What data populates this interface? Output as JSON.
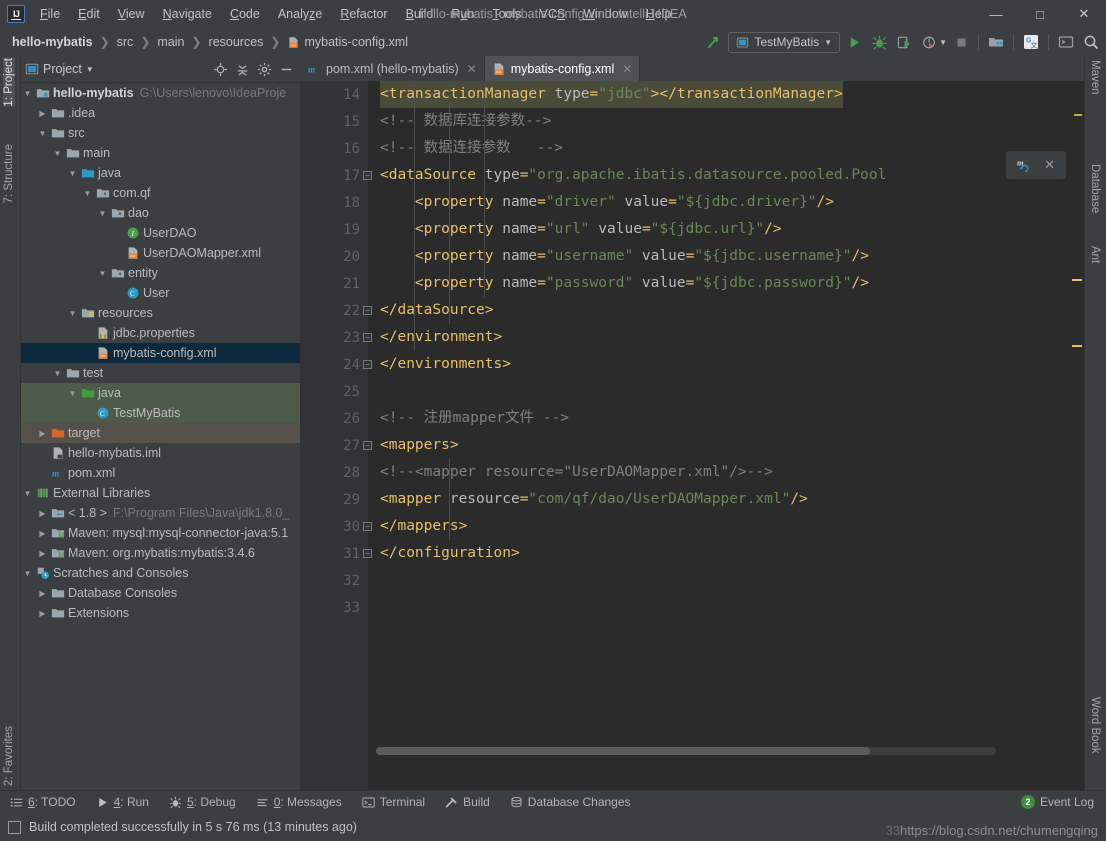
{
  "window": {
    "title": "hello-mybatis - mybatis-config.xml - IntelliJ IDEA",
    "minimize": "—",
    "maximize": "□",
    "close": "✕"
  },
  "menubar": {
    "logo": "IJ",
    "items": [
      {
        "label": "File",
        "mnemonic": "F"
      },
      {
        "label": "Edit",
        "mnemonic": "E"
      },
      {
        "label": "View",
        "mnemonic": "V"
      },
      {
        "label": "Navigate",
        "mnemonic": "N"
      },
      {
        "label": "Code",
        "mnemonic": "C"
      },
      {
        "label": "Analyze",
        "mnemonic": "z"
      },
      {
        "label": "Refactor",
        "mnemonic": "R"
      },
      {
        "label": "Build",
        "mnemonic": "B"
      },
      {
        "label": "Run",
        "mnemonic": "u"
      },
      {
        "label": "Tools",
        "mnemonic": "T"
      },
      {
        "label": "VCS",
        "mnemonic": "S"
      },
      {
        "label": "Window",
        "mnemonic": "W"
      },
      {
        "label": "Help",
        "mnemonic": "H"
      }
    ]
  },
  "breadcrumbs": [
    {
      "label": "hello-mybatis",
      "bold": true,
      "icon": ""
    },
    {
      "label": "src",
      "bold": false,
      "icon": ""
    },
    {
      "label": "main",
      "bold": false,
      "icon": ""
    },
    {
      "label": "resources",
      "bold": false,
      "icon": ""
    },
    {
      "label": "mybatis-config.xml",
      "bold": false,
      "icon": "xml-file-icon"
    }
  ],
  "toolbar": {
    "run_config": "TestMyBatis",
    "icons": [
      "make-project-icon",
      "run-icon",
      "debug-icon",
      "run-with-coverage-icon",
      "profile-icon",
      "stop-icon",
      "project-structure-icon",
      "translate-icon",
      "open-terminal-icon",
      "search-everywhere-icon"
    ]
  },
  "left_strip": {
    "project": "1: Project",
    "structure": "7: Structure",
    "favorites": "2: Favorites"
  },
  "right_strip": {
    "maven": "Maven",
    "database": "Database",
    "ant": "Ant",
    "word_book": "Word Book"
  },
  "project_panel": {
    "title": "Project",
    "actions": [
      "locate-icon",
      "collapse-all-icon",
      "settings-gear-icon",
      "hide-icon"
    ],
    "tree": [
      {
        "depth": 0,
        "twisty": "down",
        "icon": "module-folder-icon",
        "label": "hello-mybatis",
        "bold": true,
        "dim": "G:\\Users\\lenovo\\IdeaProje",
        "state": "none"
      },
      {
        "depth": 1,
        "twisty": "right",
        "icon": "folder-icon",
        "label": ".idea",
        "bold": false,
        "dim": "",
        "state": "none"
      },
      {
        "depth": 1,
        "twisty": "down",
        "icon": "folder-icon",
        "label": "src",
        "bold": false,
        "dim": "",
        "state": "none"
      },
      {
        "depth": 2,
        "twisty": "down",
        "icon": "folder-icon",
        "label": "main",
        "bold": false,
        "dim": "",
        "state": "none"
      },
      {
        "depth": 3,
        "twisty": "down",
        "icon": "source-root-icon",
        "label": "java",
        "bold": false,
        "dim": "",
        "state": "none"
      },
      {
        "depth": 4,
        "twisty": "down",
        "icon": "package-icon",
        "label": "com.qf",
        "bold": false,
        "dim": "",
        "state": "none"
      },
      {
        "depth": 5,
        "twisty": "down",
        "icon": "package-icon",
        "label": "dao",
        "bold": false,
        "dim": "",
        "state": "none"
      },
      {
        "depth": 6,
        "twisty": "none",
        "icon": "interface-icon",
        "label": "UserDAO",
        "bold": false,
        "dim": "",
        "state": "none"
      },
      {
        "depth": 6,
        "twisty": "none",
        "icon": "xml-file-icon",
        "label": "UserDAOMapper.xml",
        "bold": false,
        "dim": "",
        "state": "none"
      },
      {
        "depth": 5,
        "twisty": "down",
        "icon": "package-icon",
        "label": "entity",
        "bold": false,
        "dim": "",
        "state": "none"
      },
      {
        "depth": 6,
        "twisty": "none",
        "icon": "class-icon",
        "label": "User",
        "bold": false,
        "dim": "",
        "state": "none"
      },
      {
        "depth": 3,
        "twisty": "down",
        "icon": "resource-root-icon",
        "label": "resources",
        "bold": false,
        "dim": "",
        "state": "none"
      },
      {
        "depth": 4,
        "twisty": "none",
        "icon": "properties-file-icon",
        "label": "jdbc.properties",
        "bold": false,
        "dim": "",
        "state": "none"
      },
      {
        "depth": 4,
        "twisty": "none",
        "icon": "xml-file-icon",
        "label": "mybatis-config.xml",
        "bold": false,
        "dim": "",
        "state": "selected"
      },
      {
        "depth": 2,
        "twisty": "down",
        "icon": "folder-icon",
        "label": "test",
        "bold": false,
        "dim": "",
        "state": "none"
      },
      {
        "depth": 3,
        "twisty": "down",
        "icon": "test-source-root-icon",
        "label": "java",
        "bold": false,
        "dim": "",
        "state": "green"
      },
      {
        "depth": 4,
        "twisty": "none",
        "icon": "class-icon",
        "label": "TestMyBatis",
        "bold": false,
        "dim": "",
        "state": "green"
      },
      {
        "depth": 1,
        "twisty": "right",
        "icon": "excluded-folder-icon",
        "label": "target",
        "bold": false,
        "dim": "",
        "state": "tan"
      },
      {
        "depth": 1,
        "twisty": "none",
        "icon": "iml-file-icon",
        "label": "hello-mybatis.iml",
        "bold": false,
        "dim": "",
        "state": "none"
      },
      {
        "depth": 1,
        "twisty": "none",
        "icon": "maven-file-icon",
        "label": "pom.xml",
        "bold": false,
        "dim": "",
        "state": "none"
      },
      {
        "depth": 0,
        "twisty": "down",
        "icon": "external-libraries-icon",
        "label": "External Libraries",
        "bold": false,
        "dim": "",
        "state": "none"
      },
      {
        "depth": 1,
        "twisty": "right",
        "icon": "jdk-icon",
        "label": "< 1.8 >",
        "bold": false,
        "dim": "F:\\Program Files\\Java\\jdk1.8.0_",
        "state": "none"
      },
      {
        "depth": 1,
        "twisty": "right",
        "icon": "library-icon",
        "label": "Maven: mysql:mysql-connector-java:5.1",
        "bold": false,
        "dim": "",
        "state": "none"
      },
      {
        "depth": 1,
        "twisty": "right",
        "icon": "library-icon",
        "label": "Maven: org.mybatis:mybatis:3.4.6",
        "bold": false,
        "dim": "",
        "state": "none"
      },
      {
        "depth": 0,
        "twisty": "down",
        "icon": "scratches-icon",
        "label": "Scratches and Consoles",
        "bold": false,
        "dim": "",
        "state": "none"
      },
      {
        "depth": 1,
        "twisty": "right",
        "icon": "folder-icon",
        "label": "Database Consoles",
        "bold": false,
        "dim": "",
        "state": "none"
      },
      {
        "depth": 1,
        "twisty": "right",
        "icon": "folder-icon",
        "label": "Extensions",
        "bold": false,
        "dim": "",
        "state": "none"
      }
    ]
  },
  "editor": {
    "tabs": [
      {
        "label": "pom.xml (hello-mybatis)",
        "icon": "maven-file-icon",
        "active": false
      },
      {
        "label": "mybatis-config.xml",
        "icon": "xml-file-icon",
        "active": true
      }
    ],
    "first_line_number": 14,
    "line_numbers": [
      14,
      15,
      16,
      17,
      18,
      19,
      20,
      21,
      22,
      23,
      24,
      25,
      26,
      27,
      28,
      29,
      30,
      31,
      32,
      33
    ],
    "lines": [
      {
        "n": 14,
        "indent": 0,
        "highlight": true,
        "fold": false,
        "tokens": [
          {
            "t": "tag",
            "v": "<transactionManager "
          },
          {
            "t": "attr",
            "v": "type"
          },
          {
            "t": "tag",
            "v": "="
          },
          {
            "t": "val",
            "v": "\"jdbc\""
          },
          {
            "t": "tag",
            "v": "></transactionManager>"
          }
        ]
      },
      {
        "n": 15,
        "indent": 0,
        "highlight": false,
        "fold": false,
        "tokens": [
          {
            "t": "cmt",
            "v": "<!-- 数据库连接参数-->"
          }
        ]
      },
      {
        "n": 16,
        "indent": 0,
        "highlight": false,
        "fold": false,
        "tokens": [
          {
            "t": "cmt",
            "v": "<!-- 数据连接参数   -->"
          }
        ]
      },
      {
        "n": 17,
        "indent": 0,
        "highlight": false,
        "fold": true,
        "tokens": [
          {
            "t": "tag",
            "v": "<dataSource "
          },
          {
            "t": "attr",
            "v": "type"
          },
          {
            "t": "tag",
            "v": "="
          },
          {
            "t": "val",
            "v": "\"org.apache.ibatis.datasource.pooled.Pool"
          }
        ]
      },
      {
        "n": 18,
        "indent": 1,
        "highlight": false,
        "fold": false,
        "tokens": [
          {
            "t": "tag",
            "v": "<property "
          },
          {
            "t": "attr",
            "v": "name"
          },
          {
            "t": "tag",
            "v": "="
          },
          {
            "t": "val",
            "v": "\"driver\""
          },
          {
            "t": "attr",
            "v": " value"
          },
          {
            "t": "tag",
            "v": "="
          },
          {
            "t": "val",
            "v": "\"${jdbc.driver}\""
          },
          {
            "t": "tag",
            "v": "/>"
          }
        ]
      },
      {
        "n": 19,
        "indent": 1,
        "highlight": false,
        "fold": false,
        "tokens": [
          {
            "t": "tag",
            "v": "<property "
          },
          {
            "t": "attr",
            "v": "name"
          },
          {
            "t": "tag",
            "v": "="
          },
          {
            "t": "val",
            "v": "\"url\""
          },
          {
            "t": "attr",
            "v": " value"
          },
          {
            "t": "tag",
            "v": "="
          },
          {
            "t": "val",
            "v": "\"${jdbc.url}\""
          },
          {
            "t": "tag",
            "v": "/>"
          }
        ]
      },
      {
        "n": 20,
        "indent": 1,
        "highlight": false,
        "fold": false,
        "tokens": [
          {
            "t": "tag",
            "v": "<property "
          },
          {
            "t": "attr",
            "v": "name"
          },
          {
            "t": "tag",
            "v": "="
          },
          {
            "t": "val",
            "v": "\"username\""
          },
          {
            "t": "attr",
            "v": " value"
          },
          {
            "t": "tag",
            "v": "="
          },
          {
            "t": "val",
            "v": "\"${jdbc.username}\""
          },
          {
            "t": "tag",
            "v": "/>"
          }
        ]
      },
      {
        "n": 21,
        "indent": 1,
        "highlight": false,
        "fold": false,
        "tokens": [
          {
            "t": "tag",
            "v": "<property "
          },
          {
            "t": "attr",
            "v": "name"
          },
          {
            "t": "tag",
            "v": "="
          },
          {
            "t": "val",
            "v": "\"password\""
          },
          {
            "t": "attr",
            "v": " value"
          },
          {
            "t": "tag",
            "v": "="
          },
          {
            "t": "val",
            "v": "\"${jdbc.password}\""
          },
          {
            "t": "tag",
            "v": "/>"
          }
        ]
      },
      {
        "n": 22,
        "indent": 0,
        "highlight": false,
        "fold": true,
        "tokens": [
          {
            "t": "tag",
            "v": "</dataSource>"
          }
        ]
      },
      {
        "n": 23,
        "indent": 0,
        "highlight": false,
        "fold": true,
        "tokens": [
          {
            "t": "tag",
            "v": "</environment>"
          }
        ]
      },
      {
        "n": 24,
        "indent": 0,
        "highlight": false,
        "fold": true,
        "tokens": [
          {
            "t": "tag",
            "v": "</environments>"
          }
        ]
      },
      {
        "n": 25,
        "indent": 0,
        "highlight": false,
        "fold": false,
        "tokens": []
      },
      {
        "n": 26,
        "indent": 0,
        "highlight": false,
        "fold": false,
        "tokens": [
          {
            "t": "cmt",
            "v": "<!-- 注册mapper文件 -->"
          }
        ]
      },
      {
        "n": 27,
        "indent": 0,
        "highlight": false,
        "fold": true,
        "tokens": [
          {
            "t": "tag",
            "v": "<mappers>"
          }
        ]
      },
      {
        "n": 28,
        "indent": 0,
        "highlight": false,
        "fold": false,
        "tokens": [
          {
            "t": "cmt",
            "v": "<!--<mapper resource=\"UserDAOMapper.xml\"/>-->"
          }
        ]
      },
      {
        "n": 29,
        "indent": 0,
        "highlight": false,
        "fold": false,
        "tokens": [
          {
            "t": "tag",
            "v": "<mapper "
          },
          {
            "t": "attr",
            "v": "resource"
          },
          {
            "t": "tag",
            "v": "="
          },
          {
            "t": "val",
            "v": "\"com/qf/dao/UserDAOMapper.xml\""
          },
          {
            "t": "tag",
            "v": "/>"
          }
        ]
      },
      {
        "n": 30,
        "indent": 0,
        "highlight": false,
        "fold": true,
        "tokens": [
          {
            "t": "tag",
            "v": "</mappers>"
          }
        ]
      },
      {
        "n": 31,
        "indent": 0,
        "highlight": false,
        "fold": true,
        "tokens": [
          {
            "t": "tag",
            "v": "</configuration>"
          }
        ]
      },
      {
        "n": 32,
        "indent": 0,
        "highlight": false,
        "fold": false,
        "tokens": []
      },
      {
        "n": 33,
        "indent": 0,
        "highlight": false,
        "fold": false,
        "tokens": []
      }
    ],
    "maven_popup": {
      "icon": "maven-reload-icon",
      "close": "✕"
    }
  },
  "bottom_tools": [
    {
      "label": "6: TODO",
      "mnemonic": "6",
      "icon": "todo-icon"
    },
    {
      "label": "4: Run",
      "mnemonic": "4",
      "icon": "run-icon"
    },
    {
      "label": "5: Debug",
      "mnemonic": "5",
      "icon": "debug-icon"
    },
    {
      "label": "0: Messages",
      "mnemonic": "0",
      "icon": "messages-icon"
    },
    {
      "label": "Terminal",
      "mnemonic": "",
      "icon": "terminal-icon"
    },
    {
      "label": "Build",
      "mnemonic": "",
      "icon": "build-hammer-icon"
    },
    {
      "label": "Database Changes",
      "mnemonic": "",
      "icon": "database-changes-icon"
    }
  ],
  "event_log": {
    "label": "Event Log",
    "count": "2"
  },
  "status": {
    "message": "Build completed successfully in 5 s 76 ms (13 minutes ago)",
    "icon": "build-status-icon"
  },
  "watermark": {
    "text": "https://blog.csdn.net/chumengqing",
    "overlap": "33"
  },
  "colors": {
    "accent_blue": "#4b6eaf",
    "selection": "#0d293e",
    "editor_bg": "#2b2b2b",
    "panel_bg": "#3c3f41",
    "gutter_bg": "#313335",
    "tag": "#e8bf6a",
    "attr": "#bababa",
    "value": "#6a8759",
    "comment": "#808080",
    "green": "#499c54"
  }
}
